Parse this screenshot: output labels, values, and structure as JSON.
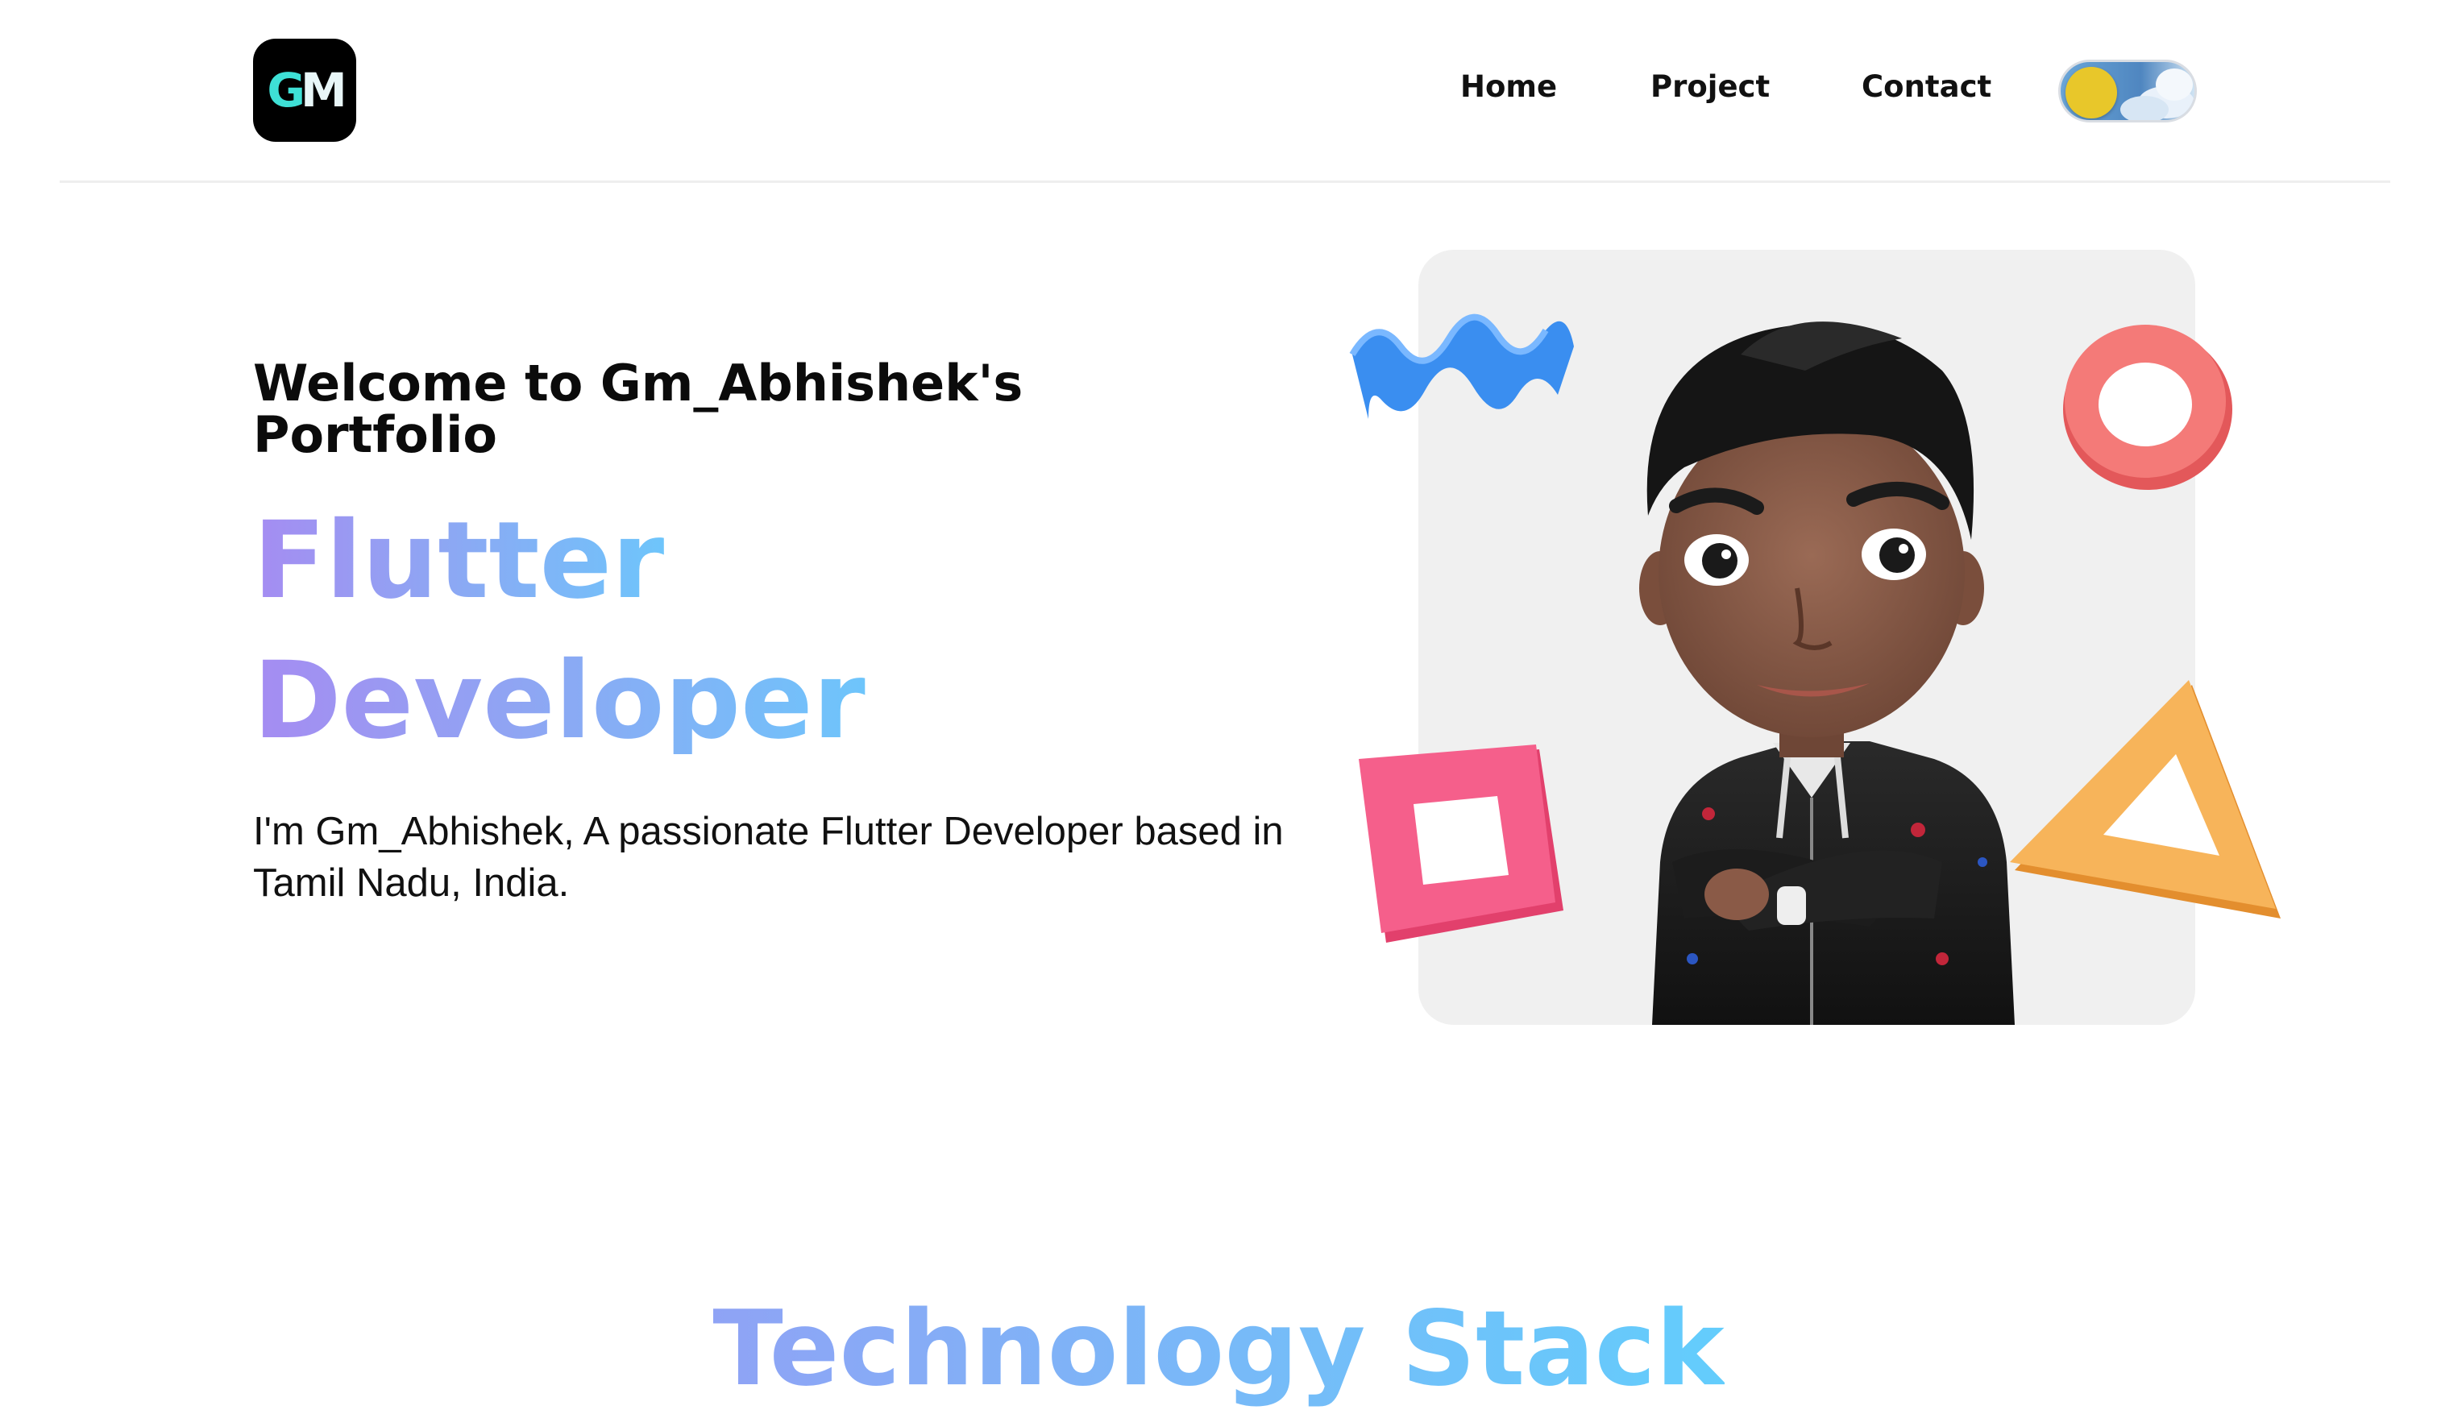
{
  "header": {
    "logo": {
      "letters": [
        "G",
        "M"
      ],
      "colors": [
        "#3ee0d6",
        "#e8f6f8"
      ],
      "background": "#000000"
    },
    "nav": {
      "home": "Home",
      "project": "Project",
      "contact": "Contact"
    },
    "theme_toggle": {
      "icon": "sun-cloud-toggle-icon",
      "state": "light",
      "knob_color": "#e8c72a",
      "track_color": "#4f86c0"
    }
  },
  "hero": {
    "welcome": "Welcome to Gm_Abhishek's Portfolio",
    "role_line1": "Flutter",
    "role_line2": "Developer",
    "intro": "I'm Gm_Abhishek, A passionate Flutter Developer based in Tamil Nadu, India.",
    "gradient_colors": [
      "#a58cf2",
      "#6ec5fb"
    ]
  },
  "avatar": {
    "icon": "memoji-avatar-icon",
    "card_color": "#f0f0f0",
    "decorations": [
      {
        "name": "wave-shape-icon",
        "color": "#3a8ef0"
      },
      {
        "name": "ring-shape-icon",
        "color": "#f26b6b"
      },
      {
        "name": "square-frame-shape-icon",
        "color": "#f2507e"
      },
      {
        "name": "triangle-shape-icon",
        "color": "#f4a94a"
      }
    ]
  },
  "sections": {
    "tech_stack_title": "Technology Stack"
  }
}
